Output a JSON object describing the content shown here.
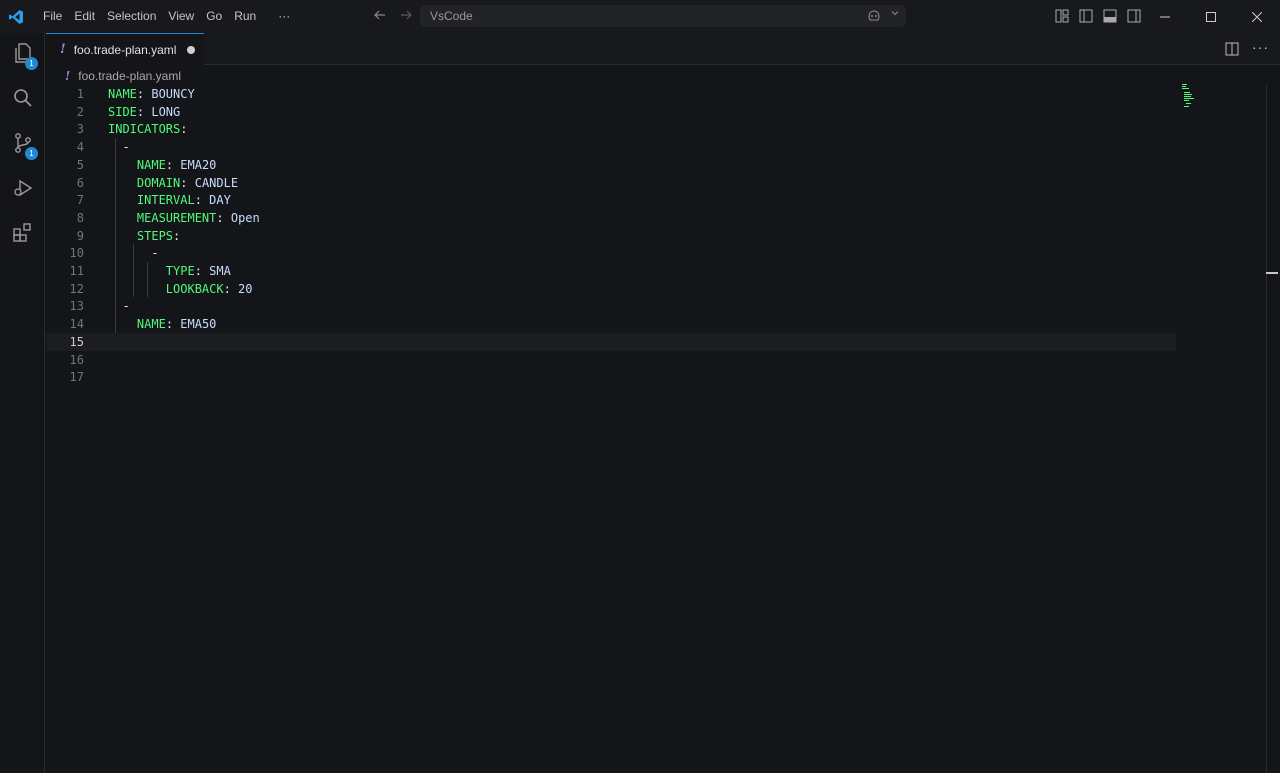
{
  "titlebar": {
    "menu": [
      "File",
      "Edit",
      "Selection",
      "View",
      "Go",
      "Run",
      "···"
    ],
    "command_center": "VsCode",
    "window_controls": [
      "minimize",
      "maximize",
      "close"
    ]
  },
  "activitybar": {
    "items": [
      {
        "icon": "explorer-icon",
        "badge": "1"
      },
      {
        "icon": "search-icon",
        "badge": ""
      },
      {
        "icon": "source-control-icon",
        "badge": "1"
      },
      {
        "icon": "run-debug-icon",
        "badge": ""
      },
      {
        "icon": "extensions-icon",
        "badge": ""
      }
    ]
  },
  "tab": {
    "icon_glyph": "!",
    "label": "foo.trade-plan.yaml",
    "dirty": true
  },
  "breadcrumb": {
    "icon_glyph": "!",
    "label": "foo.trade-plan.yaml"
  },
  "editor": {
    "current_line": 15,
    "lines": [
      {
        "n": "1",
        "indent": "",
        "key": "NAME",
        "sep": ": ",
        "value": "BOUNCY"
      },
      {
        "n": "2",
        "indent": "",
        "key": "SIDE",
        "sep": ": ",
        "value": "LONG"
      },
      {
        "n": "3",
        "indent": "",
        "key": "INDICATORS",
        "sep": ":",
        "value": ""
      },
      {
        "n": "4",
        "indent": "  ",
        "key": "",
        "sep": "-",
        "value": ""
      },
      {
        "n": "5",
        "indent": "    ",
        "key": "NAME",
        "sep": ": ",
        "value": "EMA20"
      },
      {
        "n": "6",
        "indent": "    ",
        "key": "DOMAIN",
        "sep": ": ",
        "value": "CANDLE"
      },
      {
        "n": "7",
        "indent": "    ",
        "key": "INTERVAL",
        "sep": ": ",
        "value": "DAY"
      },
      {
        "n": "8",
        "indent": "    ",
        "key": "MEASUREMENT",
        "sep": ": ",
        "value": "Open"
      },
      {
        "n": "9",
        "indent": "    ",
        "key": "STEPS",
        "sep": ":",
        "value": ""
      },
      {
        "n": "10",
        "indent": "      ",
        "key": "",
        "sep": "-",
        "value": ""
      },
      {
        "n": "11",
        "indent": "        ",
        "key": "TYPE",
        "sep": ": ",
        "value": "SMA"
      },
      {
        "n": "12",
        "indent": "        ",
        "key": "LOOKBACK",
        "sep": ": ",
        "value": "20"
      },
      {
        "n": "13",
        "indent": "  ",
        "key": "",
        "sep": "-",
        "value": ""
      },
      {
        "n": "14",
        "indent": "    ",
        "key": "NAME",
        "sep": ": ",
        "value": "EMA50"
      },
      {
        "n": "15",
        "indent": "",
        "key": "",
        "sep": "",
        "value": ""
      },
      {
        "n": "16",
        "indent": "",
        "key": "",
        "sep": "",
        "value": ""
      },
      {
        "n": "17",
        "indent": "",
        "key": "",
        "sep": "",
        "value": ""
      }
    ]
  },
  "colors": {
    "accent": "#1f8ad2",
    "yaml_key": "#50fa7b",
    "yaml_value": "#c8dcff",
    "yaml_icon": "#b180d7"
  }
}
